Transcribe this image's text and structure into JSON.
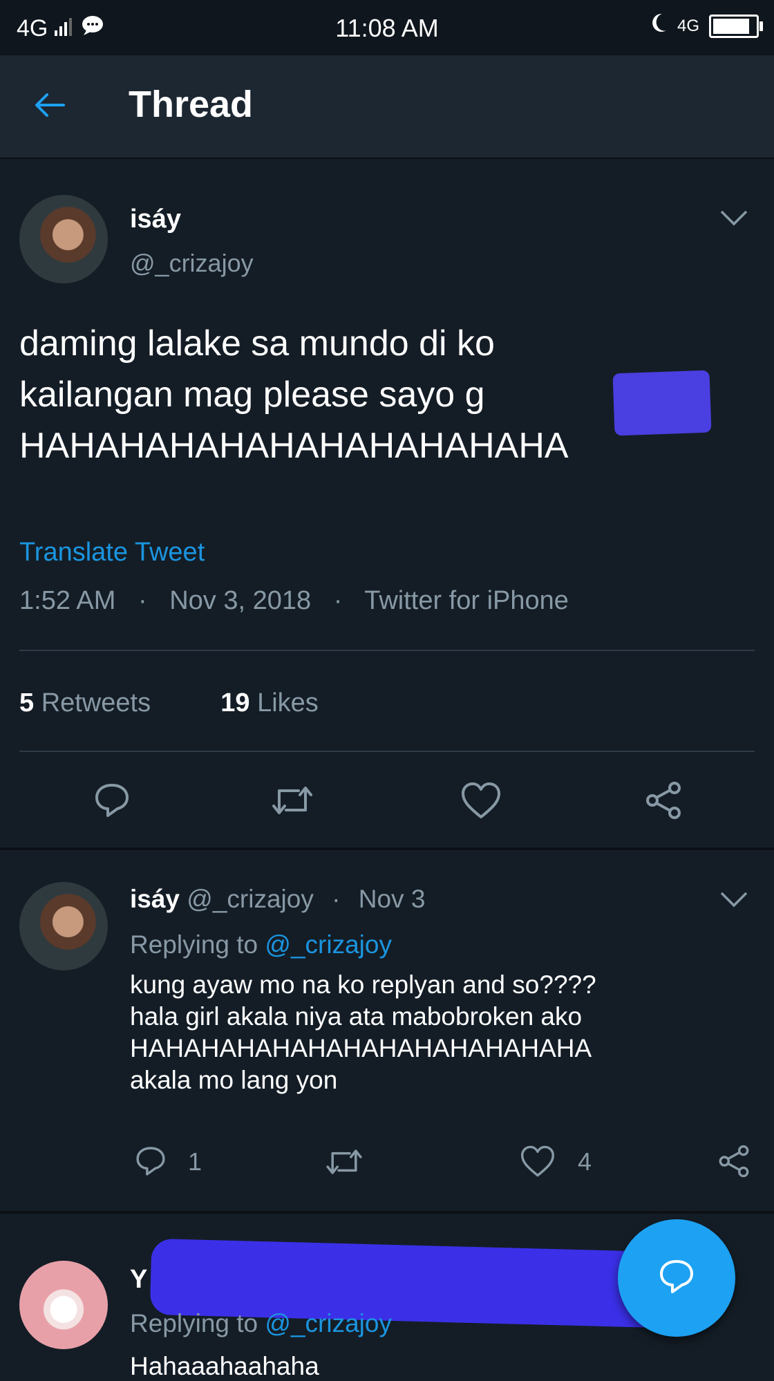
{
  "status_bar": {
    "network": "4G",
    "time": "11:08 AM",
    "net_right": "4G"
  },
  "header": {
    "back_icon": "back-arrow-icon",
    "title": "Thread"
  },
  "main_tweet": {
    "name": "isáy",
    "handle": "@_crizajoy",
    "text_lines": [
      "daming lalake sa mundo di ko",
      "kailangan mag please sayo g",
      "HAHAHAHAHAHAHAHAHAHAHA"
    ],
    "translate": "Translate Tweet",
    "meta_time": "1:52 AM",
    "meta_date": "Nov 3, 2018",
    "meta_source": "Twitter for iPhone",
    "retweets_count": "5",
    "retweets_label": "Retweets",
    "likes_count": "19",
    "likes_label": "Likes"
  },
  "reply1": {
    "name": "isáy",
    "handle": "@_crizajoy",
    "date": "Nov 3",
    "replying_prefix": "Replying to",
    "replying_handle": "@_crizajoy",
    "text_lines": [
      "kung ayaw mo na ko replyan and so????",
      "hala girl akala niya ata mabobroken ako",
      "HAHAHAHAHAHAHAHAHAHAHAHAHA",
      "akala mo lang yon"
    ],
    "reply_count": "1",
    "like_count": "4"
  },
  "reply2": {
    "name_visible": "Y",
    "replying_prefix": "Replying to",
    "replying_handle": "@_crizajoy",
    "text": "Hahaaahaahaha"
  },
  "colors": {
    "background": "#141d26",
    "header": "#1c2732",
    "accent": "#1da1f2",
    "muted": "#8899a6",
    "redaction": "#4a3fe0"
  }
}
